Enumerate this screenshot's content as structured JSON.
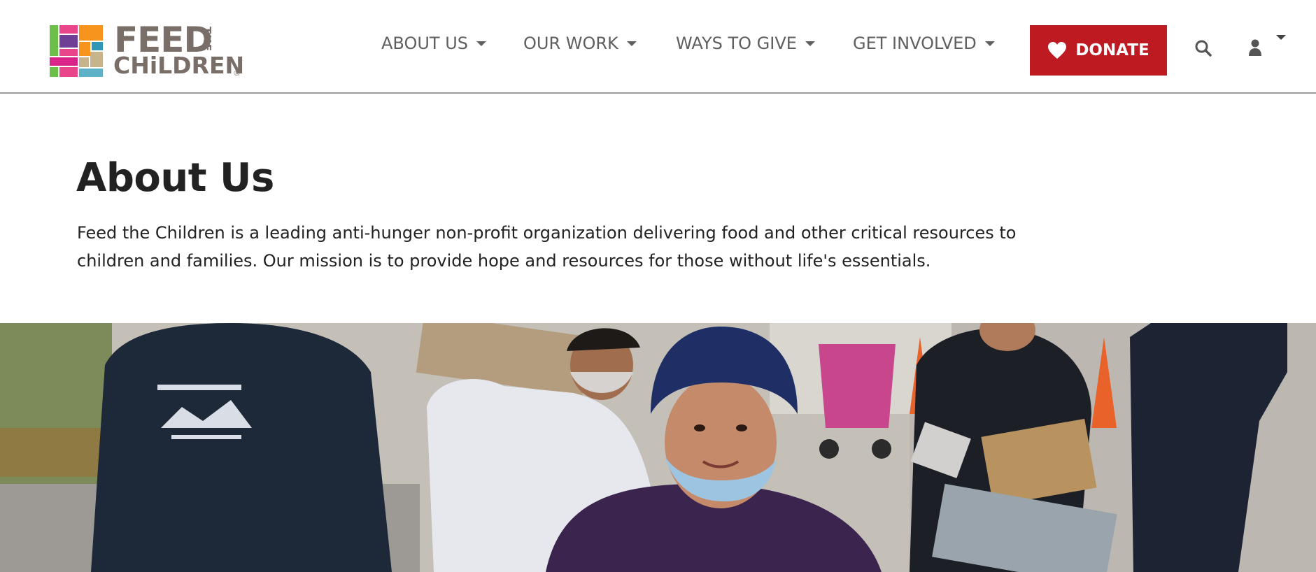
{
  "brand": {
    "logo_line1": "FEED",
    "logo_the": "THE",
    "logo_line2": "CHiLDREN",
    "logo_registered": "®"
  },
  "nav": {
    "items": [
      {
        "label": "ABOUT US"
      },
      {
        "label": "OUR WORK"
      },
      {
        "label": "WAYS TO GIVE"
      },
      {
        "label": "GET INVOLVED"
      }
    ],
    "donate_label": "DONATE",
    "icons": {
      "donate": "heart-icon",
      "search": "search-icon",
      "account": "user-icon",
      "account_menu": "chevron-down-icon"
    }
  },
  "colors": {
    "donate_bg": "#be1a22",
    "nav_text": "#5f5f5f",
    "logo_text": "#7a6f68"
  },
  "intro": {
    "title": "About Us",
    "body": "Feed the Children is a leading anti-hunger non-profit organization delivering food and other critical resources to children and families. Our mission is to provide hope and resources for those without life's essentials."
  }
}
